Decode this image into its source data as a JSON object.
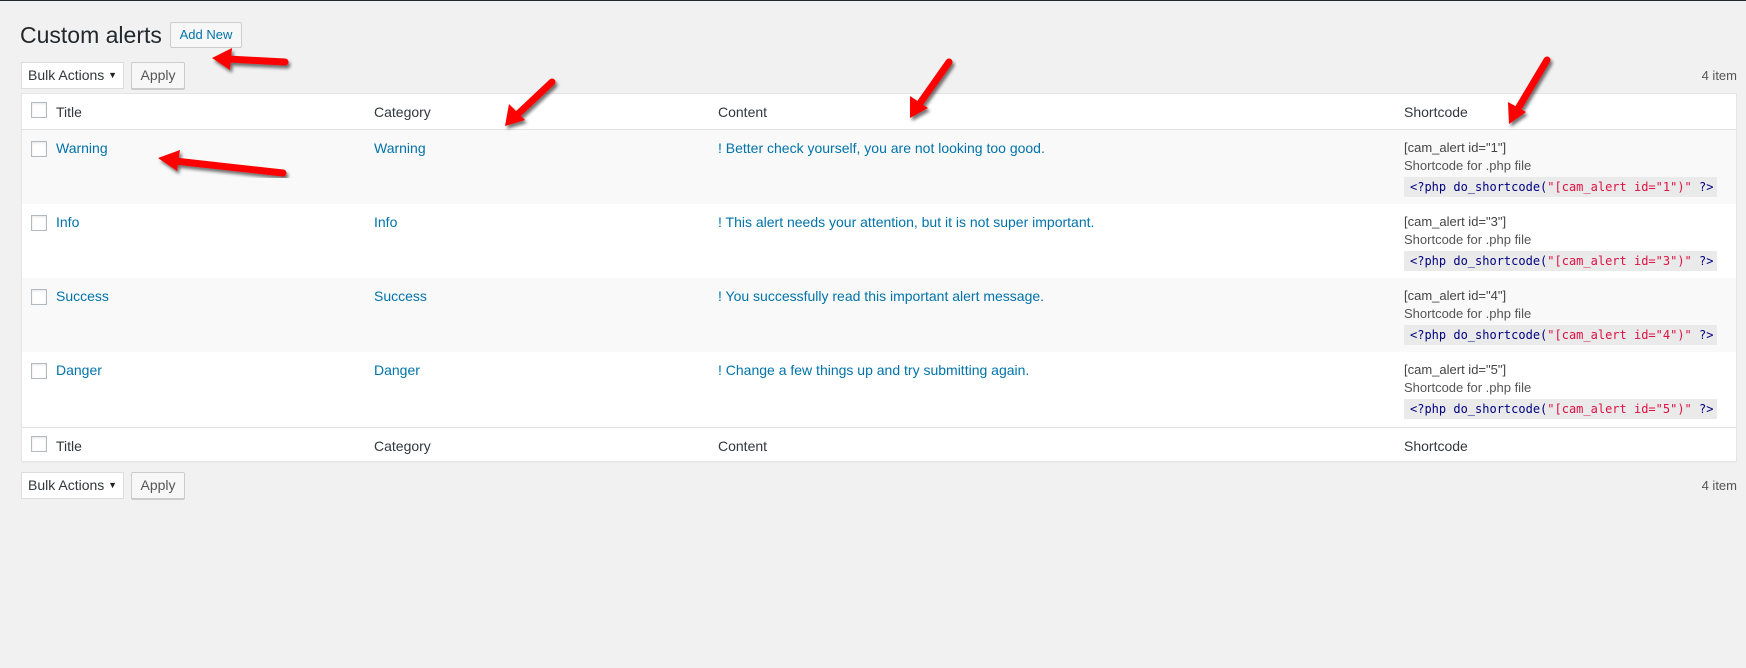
{
  "page": {
    "title": "Custom alerts",
    "add_new_label": "Add New"
  },
  "tablenav_top": {
    "bulk_actions_selected": "Bulk Actions",
    "apply_label": "Apply",
    "item_count": "4 item"
  },
  "tablenav_bottom": {
    "bulk_actions_selected": "Bulk Actions",
    "apply_label": "Apply",
    "item_count": "4 item"
  },
  "table": {
    "columns": [
      "Title",
      "Category",
      "Content",
      "Shortcode"
    ],
    "rows": [
      {
        "title": "Warning",
        "category": "Warning",
        "content": "! Better check yourself, you are not looking too good.",
        "shortcode": "[cam_alert id=\"1\"]",
        "php_label": "Shortcode for .php file",
        "php_open": "<?php do_shortcode(",
        "php_string": "\"[cam_alert id=\"1\")\"",
        "php_close": " ?>"
      },
      {
        "title": "Info",
        "category": "Info",
        "content": "! This alert needs your attention, but it is not super important.",
        "shortcode": "[cam_alert id=\"3\"]",
        "php_label": "Shortcode for .php file",
        "php_open": "<?php do_shortcode(",
        "php_string": "\"[cam_alert id=\"3\")\"",
        "php_close": " ?>"
      },
      {
        "title": "Success",
        "category": "Success",
        "content": "! You successfully read this important alert message.",
        "shortcode": "[cam_alert id=\"4\"]",
        "php_label": "Shortcode for .php file",
        "php_open": "<?php do_shortcode(",
        "php_string": "\"[cam_alert id=\"4\")\"",
        "php_close": " ?>"
      },
      {
        "title": "Danger",
        "category": "Danger",
        "content": "! Change a few things up and try submitting again.",
        "shortcode": "[cam_alert id=\"5\"]",
        "php_label": "Shortcode for .php file",
        "php_open": "<?php do_shortcode(",
        "php_string": "\"[cam_alert id=\"5\")\"",
        "php_close": " ?>"
      }
    ]
  },
  "colors": {
    "link": "#0073aa",
    "annotation_arrow": "#ff0000",
    "background": "#f1f1f1"
  },
  "annotations": {
    "arrow_count": 5,
    "arrow_icon": "red-arrow-icon"
  }
}
